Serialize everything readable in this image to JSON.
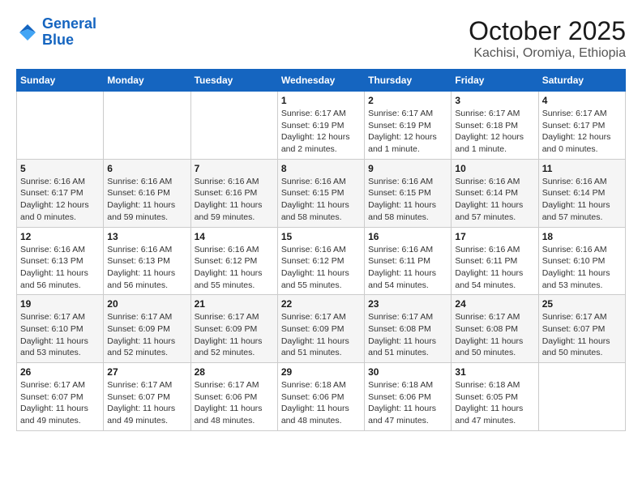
{
  "header": {
    "logo_line1": "General",
    "logo_line2": "Blue",
    "month_title": "October 2025",
    "location": "Kachisi, Oromiya, Ethiopia"
  },
  "weekdays": [
    "Sunday",
    "Monday",
    "Tuesday",
    "Wednesday",
    "Thursday",
    "Friday",
    "Saturday"
  ],
  "weeks": [
    [
      {
        "day": "",
        "info": ""
      },
      {
        "day": "",
        "info": ""
      },
      {
        "day": "",
        "info": ""
      },
      {
        "day": "1",
        "info": "Sunrise: 6:17 AM\nSunset: 6:19 PM\nDaylight: 12 hours and 2 minutes."
      },
      {
        "day": "2",
        "info": "Sunrise: 6:17 AM\nSunset: 6:19 PM\nDaylight: 12 hours and 1 minute."
      },
      {
        "day": "3",
        "info": "Sunrise: 6:17 AM\nSunset: 6:18 PM\nDaylight: 12 hours and 1 minute."
      },
      {
        "day": "4",
        "info": "Sunrise: 6:17 AM\nSunset: 6:17 PM\nDaylight: 12 hours and 0 minutes."
      }
    ],
    [
      {
        "day": "5",
        "info": "Sunrise: 6:16 AM\nSunset: 6:17 PM\nDaylight: 12 hours and 0 minutes."
      },
      {
        "day": "6",
        "info": "Sunrise: 6:16 AM\nSunset: 6:16 PM\nDaylight: 11 hours and 59 minutes."
      },
      {
        "day": "7",
        "info": "Sunrise: 6:16 AM\nSunset: 6:16 PM\nDaylight: 11 hours and 59 minutes."
      },
      {
        "day": "8",
        "info": "Sunrise: 6:16 AM\nSunset: 6:15 PM\nDaylight: 11 hours and 58 minutes."
      },
      {
        "day": "9",
        "info": "Sunrise: 6:16 AM\nSunset: 6:15 PM\nDaylight: 11 hours and 58 minutes."
      },
      {
        "day": "10",
        "info": "Sunrise: 6:16 AM\nSunset: 6:14 PM\nDaylight: 11 hours and 57 minutes."
      },
      {
        "day": "11",
        "info": "Sunrise: 6:16 AM\nSunset: 6:14 PM\nDaylight: 11 hours and 57 minutes."
      }
    ],
    [
      {
        "day": "12",
        "info": "Sunrise: 6:16 AM\nSunset: 6:13 PM\nDaylight: 11 hours and 56 minutes."
      },
      {
        "day": "13",
        "info": "Sunrise: 6:16 AM\nSunset: 6:13 PM\nDaylight: 11 hours and 56 minutes."
      },
      {
        "day": "14",
        "info": "Sunrise: 6:16 AM\nSunset: 6:12 PM\nDaylight: 11 hours and 55 minutes."
      },
      {
        "day": "15",
        "info": "Sunrise: 6:16 AM\nSunset: 6:12 PM\nDaylight: 11 hours and 55 minutes."
      },
      {
        "day": "16",
        "info": "Sunrise: 6:16 AM\nSunset: 6:11 PM\nDaylight: 11 hours and 54 minutes."
      },
      {
        "day": "17",
        "info": "Sunrise: 6:16 AM\nSunset: 6:11 PM\nDaylight: 11 hours and 54 minutes."
      },
      {
        "day": "18",
        "info": "Sunrise: 6:16 AM\nSunset: 6:10 PM\nDaylight: 11 hours and 53 minutes."
      }
    ],
    [
      {
        "day": "19",
        "info": "Sunrise: 6:17 AM\nSunset: 6:10 PM\nDaylight: 11 hours and 53 minutes."
      },
      {
        "day": "20",
        "info": "Sunrise: 6:17 AM\nSunset: 6:09 PM\nDaylight: 11 hours and 52 minutes."
      },
      {
        "day": "21",
        "info": "Sunrise: 6:17 AM\nSunset: 6:09 PM\nDaylight: 11 hours and 52 minutes."
      },
      {
        "day": "22",
        "info": "Sunrise: 6:17 AM\nSunset: 6:09 PM\nDaylight: 11 hours and 51 minutes."
      },
      {
        "day": "23",
        "info": "Sunrise: 6:17 AM\nSunset: 6:08 PM\nDaylight: 11 hours and 51 minutes."
      },
      {
        "day": "24",
        "info": "Sunrise: 6:17 AM\nSunset: 6:08 PM\nDaylight: 11 hours and 50 minutes."
      },
      {
        "day": "25",
        "info": "Sunrise: 6:17 AM\nSunset: 6:07 PM\nDaylight: 11 hours and 50 minutes."
      }
    ],
    [
      {
        "day": "26",
        "info": "Sunrise: 6:17 AM\nSunset: 6:07 PM\nDaylight: 11 hours and 49 minutes."
      },
      {
        "day": "27",
        "info": "Sunrise: 6:17 AM\nSunset: 6:07 PM\nDaylight: 11 hours and 49 minutes."
      },
      {
        "day": "28",
        "info": "Sunrise: 6:17 AM\nSunset: 6:06 PM\nDaylight: 11 hours and 48 minutes."
      },
      {
        "day": "29",
        "info": "Sunrise: 6:18 AM\nSunset: 6:06 PM\nDaylight: 11 hours and 48 minutes."
      },
      {
        "day": "30",
        "info": "Sunrise: 6:18 AM\nSunset: 6:06 PM\nDaylight: 11 hours and 47 minutes."
      },
      {
        "day": "31",
        "info": "Sunrise: 6:18 AM\nSunset: 6:05 PM\nDaylight: 11 hours and 47 minutes."
      },
      {
        "day": "",
        "info": ""
      }
    ]
  ]
}
